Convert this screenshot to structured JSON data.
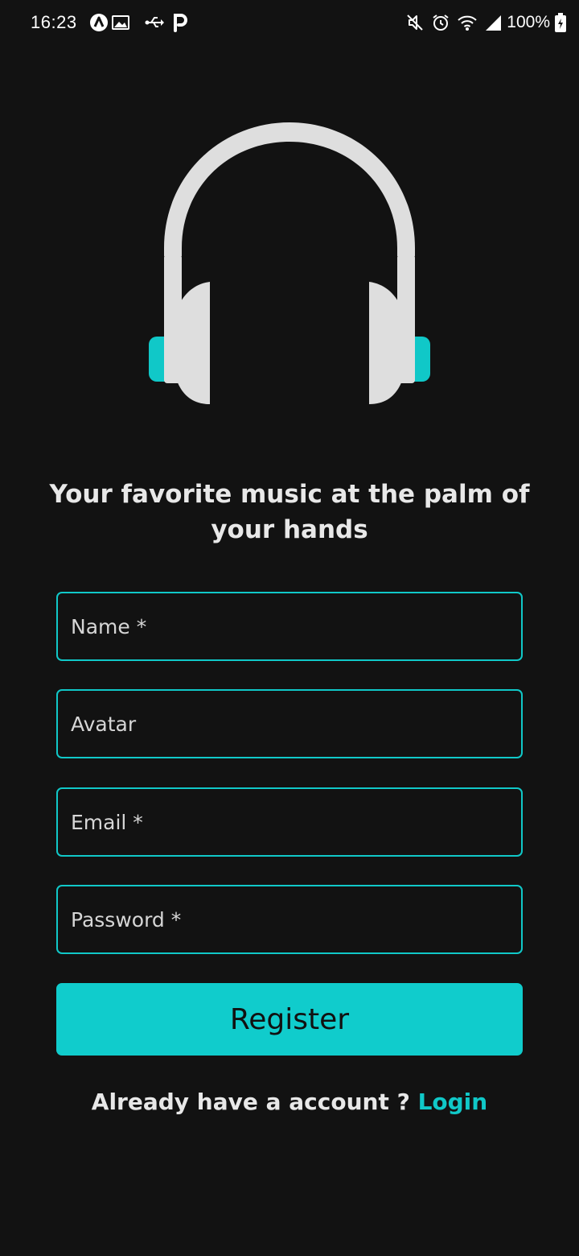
{
  "status_bar": {
    "time": "16:23",
    "battery": "100%",
    "left_icons": [
      "auto-brightness-icon",
      "image-icon",
      "usb-icon",
      "parking-icon"
    ],
    "right_icons": [
      "mute-icon",
      "alarm-icon",
      "wifi-icon",
      "signal-icon",
      "battery-icon"
    ]
  },
  "logo": {
    "icon": "headphones-icon",
    "band_color": "#dedede",
    "accent_color": "#10c8c8"
  },
  "tagline": "Your favorite music at the palm of your hands",
  "form": {
    "name_placeholder": "Name *",
    "avatar_placeholder": "Avatar",
    "email_placeholder": "Email *",
    "password_placeholder": "Password *",
    "name_value": "",
    "avatar_value": "",
    "email_value": "",
    "password_value": "",
    "register_label": "Register"
  },
  "footer": {
    "prompt": "Already have a account ? ",
    "login_label": "Login"
  },
  "colors": {
    "background": "#121212",
    "accent": "#10cccc",
    "text": "#e8e8e8"
  }
}
